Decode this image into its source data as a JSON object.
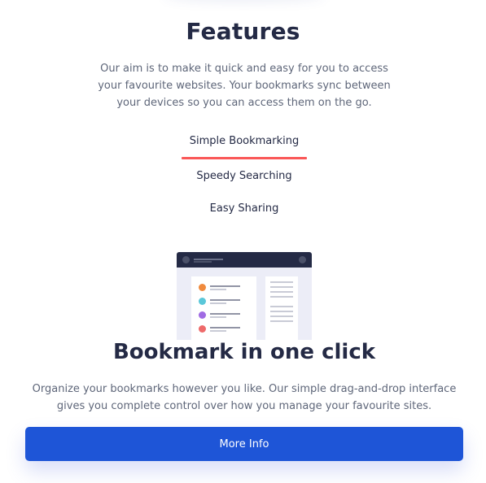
{
  "features": {
    "title": "Features",
    "intro": "Our aim is to make it quick and easy for you to access your favourite websites. Your bookmarks sync between your devices so you can access them on the go."
  },
  "tabs": [
    {
      "label": "Simple Bookmarking",
      "active": true
    },
    {
      "label": "Speedy Searching",
      "active": false
    },
    {
      "label": "Easy Sharing",
      "active": false
    }
  ],
  "illustration": {
    "dot_colors": [
      "#f08a3d",
      "#5ac7d9",
      "#a06be3",
      "#ee6a6a"
    ]
  },
  "panel": {
    "heading": "Bookmark in one click",
    "description": "Organize your bookmarks however you like. Our simple drag-and-drop interface gives you complete control over how you manage your favourite sites.",
    "button_label": "More Info"
  },
  "colors": {
    "accent_red": "#fa5757",
    "button_blue": "#1e55d7",
    "heading_navy": "#242a45"
  }
}
